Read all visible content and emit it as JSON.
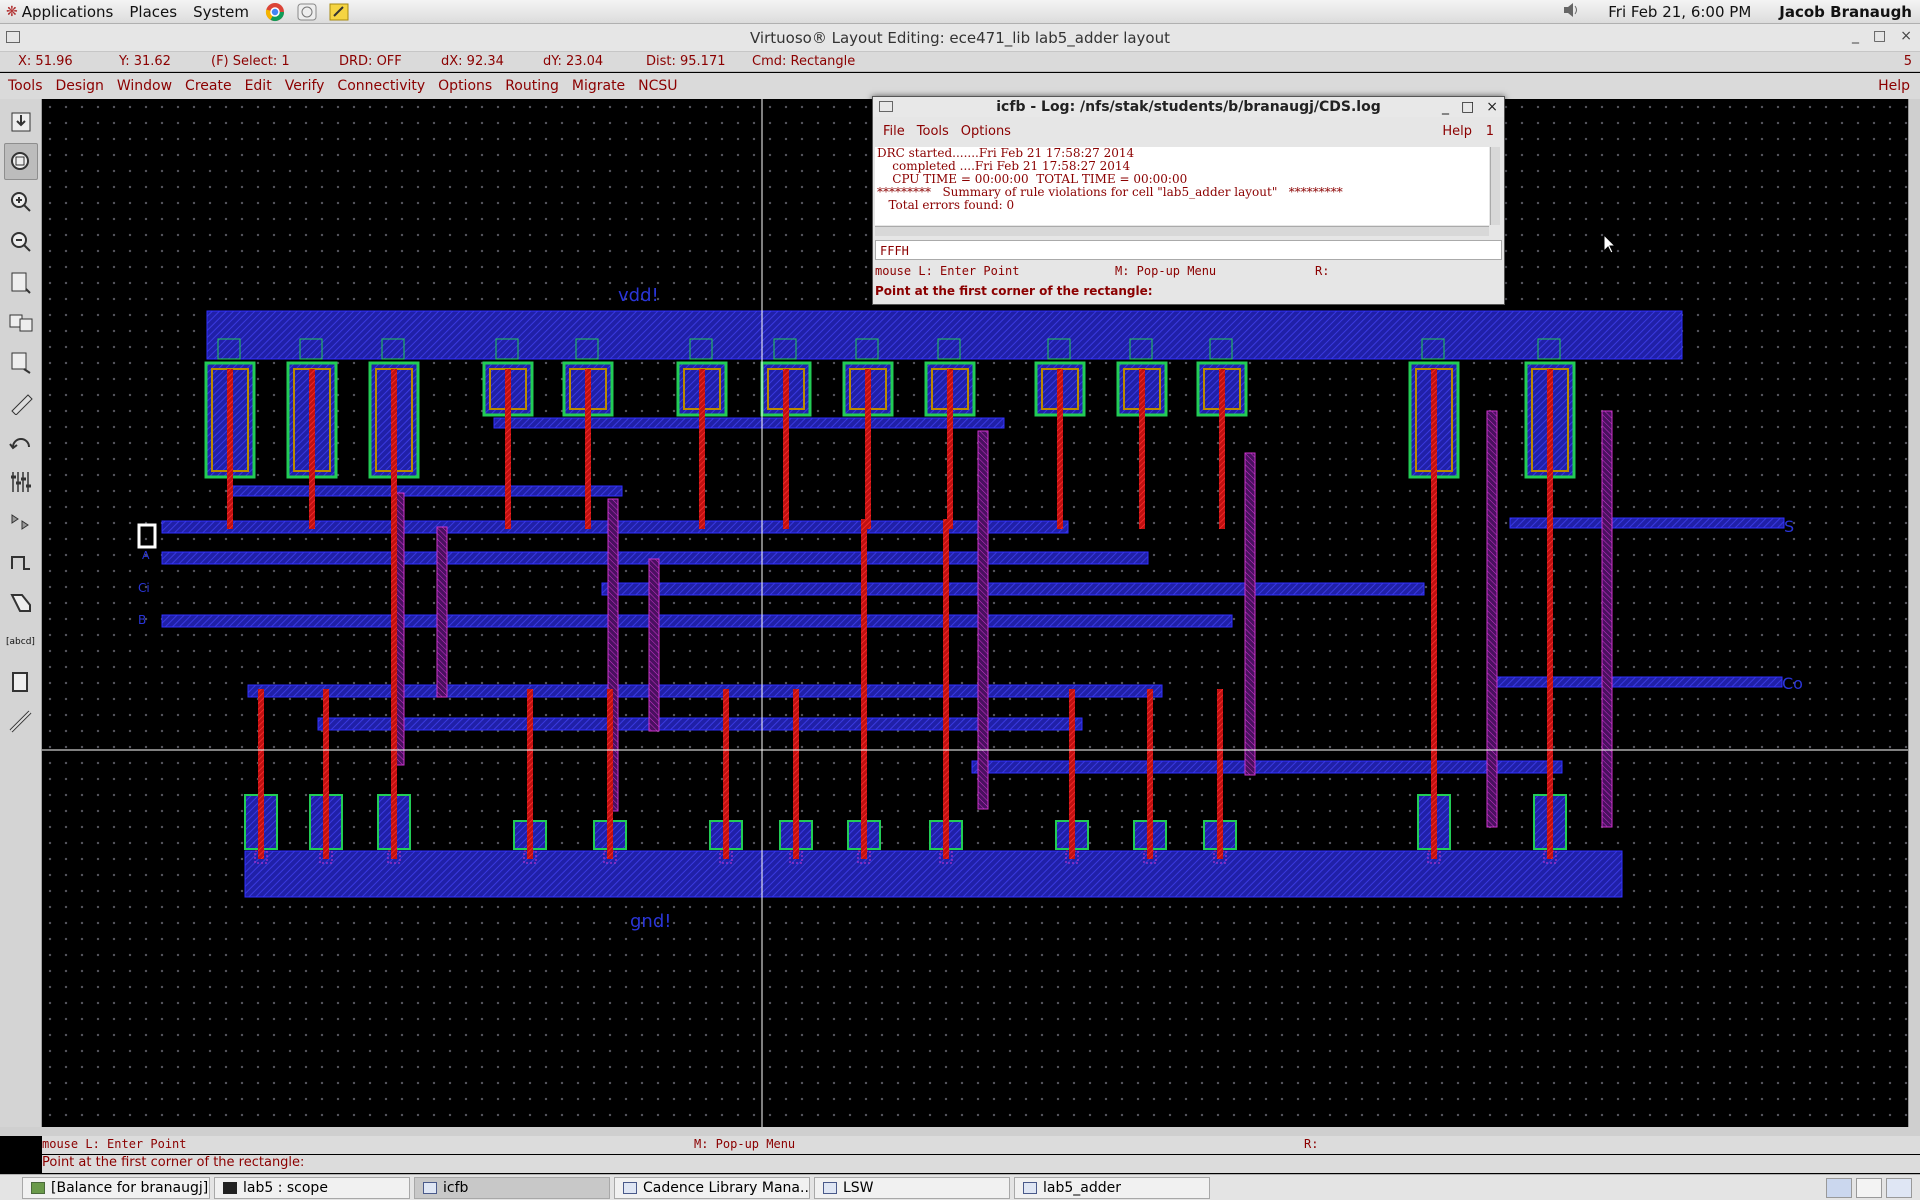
{
  "top_panel": {
    "menus": [
      "Applications",
      "Places",
      "System"
    ],
    "launchers": [
      "chrome-icon",
      "network-icon",
      "notes-icon"
    ],
    "datetime": "Fri Feb 21,  6:00 PM",
    "user": "Jacob Branaugh"
  },
  "window": {
    "title": "Virtuoso® Layout Editing: ece471_lib lab5_adder layout",
    "controls": [
      "_",
      "□",
      "×"
    ]
  },
  "status_row": {
    "x": "X: 51.96",
    "y": "Y: 31.62",
    "select": "(F) Select: 1",
    "drd": "DRD: OFF",
    "dx": "dX: 92.34",
    "dy": "dY: 23.04",
    "dist": "Dist: 95.171",
    "cmd": "Cmd: Rectangle",
    "flag": "5"
  },
  "menu_bar": {
    "items": [
      "Tools",
      "Design",
      "Window",
      "Create",
      "Edit",
      "Verify",
      "Connectivity",
      "Options",
      "Routing",
      "Migrate",
      "NCSU"
    ],
    "help": "Help"
  },
  "toolbar": {
    "tools": [
      "save-icon",
      "fit-icon",
      "zoom-in-icon",
      "zoom-out-icon",
      "stretch-icon",
      "copy-icon",
      "move-icon",
      "delete-icon",
      "undo-icon",
      "properties-icon",
      "instance-icon",
      "path-icon",
      "polygon-icon",
      "label-icon",
      "rectangle-icon",
      "ruler-icon"
    ],
    "active": "fit-icon",
    "label_tool_text": "[abcd]"
  },
  "layout": {
    "pins": [
      "vdd!",
      "gnd!",
      "A",
      "B",
      "Ci",
      "S",
      "Co"
    ],
    "colors": {
      "metal1": "#2222cc",
      "poly": "#dd1111",
      "metal2": "#cc33cc",
      "active": "#22cc55",
      "nselect": "#bb8a00",
      "crosshair": "#ffffff"
    }
  },
  "log_window": {
    "title": "icfb - Log: /nfs/stak/students/b/branaugj/CDS.log",
    "controls": [
      "_",
      "□",
      "×"
    ],
    "menus": [
      "File",
      "Tools",
      "Options"
    ],
    "help": "Help",
    "number": "1",
    "lines": [
      "DRC started.......Fri Feb 21 17:58:27 2014",
      "    completed ....Fri Feb 21 17:58:27 2014",
      "    CPU TIME = 00:00:00  TOTAL TIME = 00:00:00",
      "*********   Summary of rule violations for cell \"lab5_adder layout\"   *********",
      "   Total errors found: 0"
    ],
    "input_value": "FFFH",
    "mouse_l": "mouse L: Enter Point",
    "mouse_m": "M: Pop-up Menu",
    "mouse_r": "R:",
    "prompt": "Point at the first corner of the rectangle:"
  },
  "bottom": {
    "mouse_l": "mouse L: Enter Point",
    "mouse_m": "M: Pop-up Menu",
    "mouse_r": "R:",
    "prompt": "Point at the first corner of the rectangle:"
  },
  "taskbar": {
    "items": [
      {
        "label": "[Balance for branaugj]",
        "icon": "terminal-icon"
      },
      {
        "label": "lab5 : scope",
        "icon": "terminal-icon"
      },
      {
        "label": "icfb",
        "icon": "window-icon"
      },
      {
        "label": "Cadence Library Mana...",
        "icon": "window-icon"
      },
      {
        "label": "LSW",
        "icon": "window-icon"
      },
      {
        "label": "lab5_adder",
        "icon": "window-icon"
      }
    ],
    "active_index": 2
  }
}
